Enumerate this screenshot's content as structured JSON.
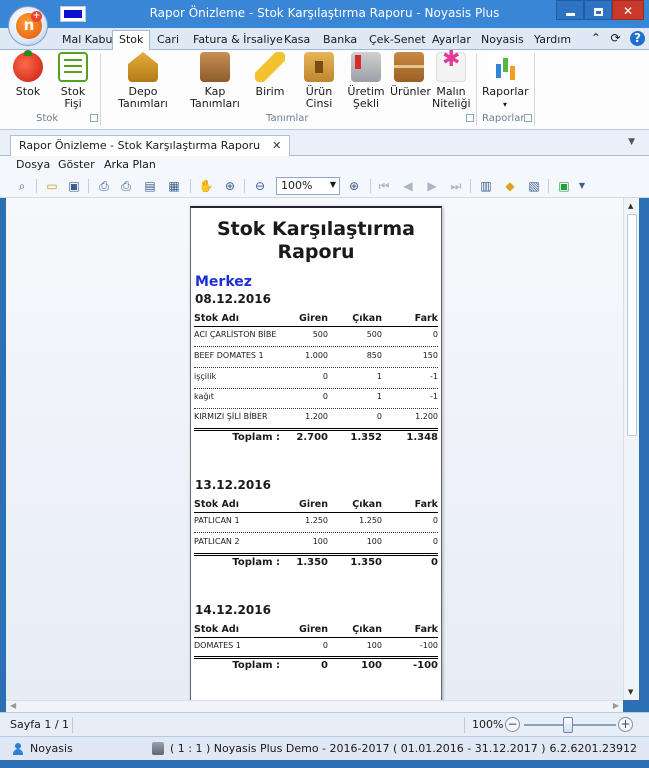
{
  "window": {
    "title": "Rapor Önizleme - Stok Karşılaştırma Raporu - Noyasis Plus"
  },
  "ribbon_tabs": [
    {
      "label": "Mal Kabul"
    },
    {
      "label": "Stok"
    },
    {
      "label": "Cari"
    },
    {
      "label": "Fatura & İrsaliye"
    },
    {
      "label": "Kasa"
    },
    {
      "label": "Banka"
    },
    {
      "label": "Çek-Senet"
    },
    {
      "label": "Ayarlar"
    },
    {
      "label": "Noyasis"
    },
    {
      "label": "Yardım"
    }
  ],
  "ribbon": {
    "buttons": [
      {
        "label": "Stok",
        "icon": "tomato-icon"
      },
      {
        "label": "Stok Fişi",
        "icon": "list-icon"
      },
      {
        "label": "Depo Tanımları",
        "icon": "warehouse-icon"
      },
      {
        "label": "Kap Tanımları",
        "icon": "box-icon"
      },
      {
        "label": "Birim",
        "icon": "ruler-icon"
      },
      {
        "label": "Ürün Cinsi",
        "icon": "product-icon"
      },
      {
        "label": "Üretim Şekli",
        "icon": "factory-icon"
      },
      {
        "label": "Ürünler",
        "icon": "boxes-icon"
      },
      {
        "label": "Malın Niteliği",
        "icon": "quality-icon"
      },
      {
        "label": "Raporlar",
        "icon": "chart-icon"
      }
    ],
    "groups": [
      {
        "label": "Stok"
      },
      {
        "label": "Tanımlar"
      },
      {
        "label": "Raporlar"
      }
    ]
  },
  "doc_tab": {
    "label": "Rapor Önizleme - Stok Karşılaştırma Raporu"
  },
  "menu": {
    "items": [
      {
        "label": "Dosya"
      },
      {
        "label": "Göster"
      },
      {
        "label": "Arka Plan"
      }
    ]
  },
  "toolbar": {
    "zoom": "100%"
  },
  "report": {
    "title_line1": "Stok Karşılaştırma",
    "title_line2": "Raporu",
    "branch": "Merkez",
    "columns": {
      "name": "Stok Adı",
      "giren": "Giren",
      "cikan": "Çıkan",
      "fark": "Fark"
    },
    "total_label": "Toplam :",
    "sections": [
      {
        "date": "08.12.2016",
        "rows": [
          {
            "name": "ACI ÇARLİSTON BİBE",
            "giren": "500",
            "cikan": "500",
            "fark": "0"
          },
          {
            "name": "BEEF DOMATES 1",
            "giren": "1.000",
            "cikan": "850",
            "fark": "150"
          },
          {
            "name": "işçilik",
            "giren": "0",
            "cikan": "1",
            "fark": "-1"
          },
          {
            "name": "kağıt",
            "giren": "0",
            "cikan": "1",
            "fark": "-1"
          },
          {
            "name": "KIRMIZI ŞİLİ BİBER",
            "giren": "1.200",
            "cikan": "0",
            "fark": "1.200"
          }
        ],
        "total": {
          "giren": "2.700",
          "cikan": "1.352",
          "fark": "1.348"
        }
      },
      {
        "date": "13.12.2016",
        "rows": [
          {
            "name": "PATLICAN 1",
            "giren": "1.250",
            "cikan": "1.250",
            "fark": "0"
          },
          {
            "name": "PATLICAN 2",
            "giren": "100",
            "cikan": "100",
            "fark": "0"
          }
        ],
        "total": {
          "giren": "1.350",
          "cikan": "1.350",
          "fark": "0"
        }
      },
      {
        "date": "14.12.2016",
        "rows": [
          {
            "name": "DOMATES 1",
            "giren": "0",
            "cikan": "100",
            "fark": "-100"
          }
        ],
        "total": {
          "giren": "0",
          "cikan": "100",
          "fark": "-100"
        }
      }
    ]
  },
  "status": {
    "page": "Sayfa 1 / 1",
    "zoom": "100%",
    "zoom_minus": "−",
    "zoom_plus": "+"
  },
  "info": {
    "user": "Noyasis",
    "company": "( 1 : 1 )  Noyasis Plus Demo - 2016-2017  ( 01.01.2016 - 31.12.2017 )",
    "version": "6.2.6201.23912"
  }
}
